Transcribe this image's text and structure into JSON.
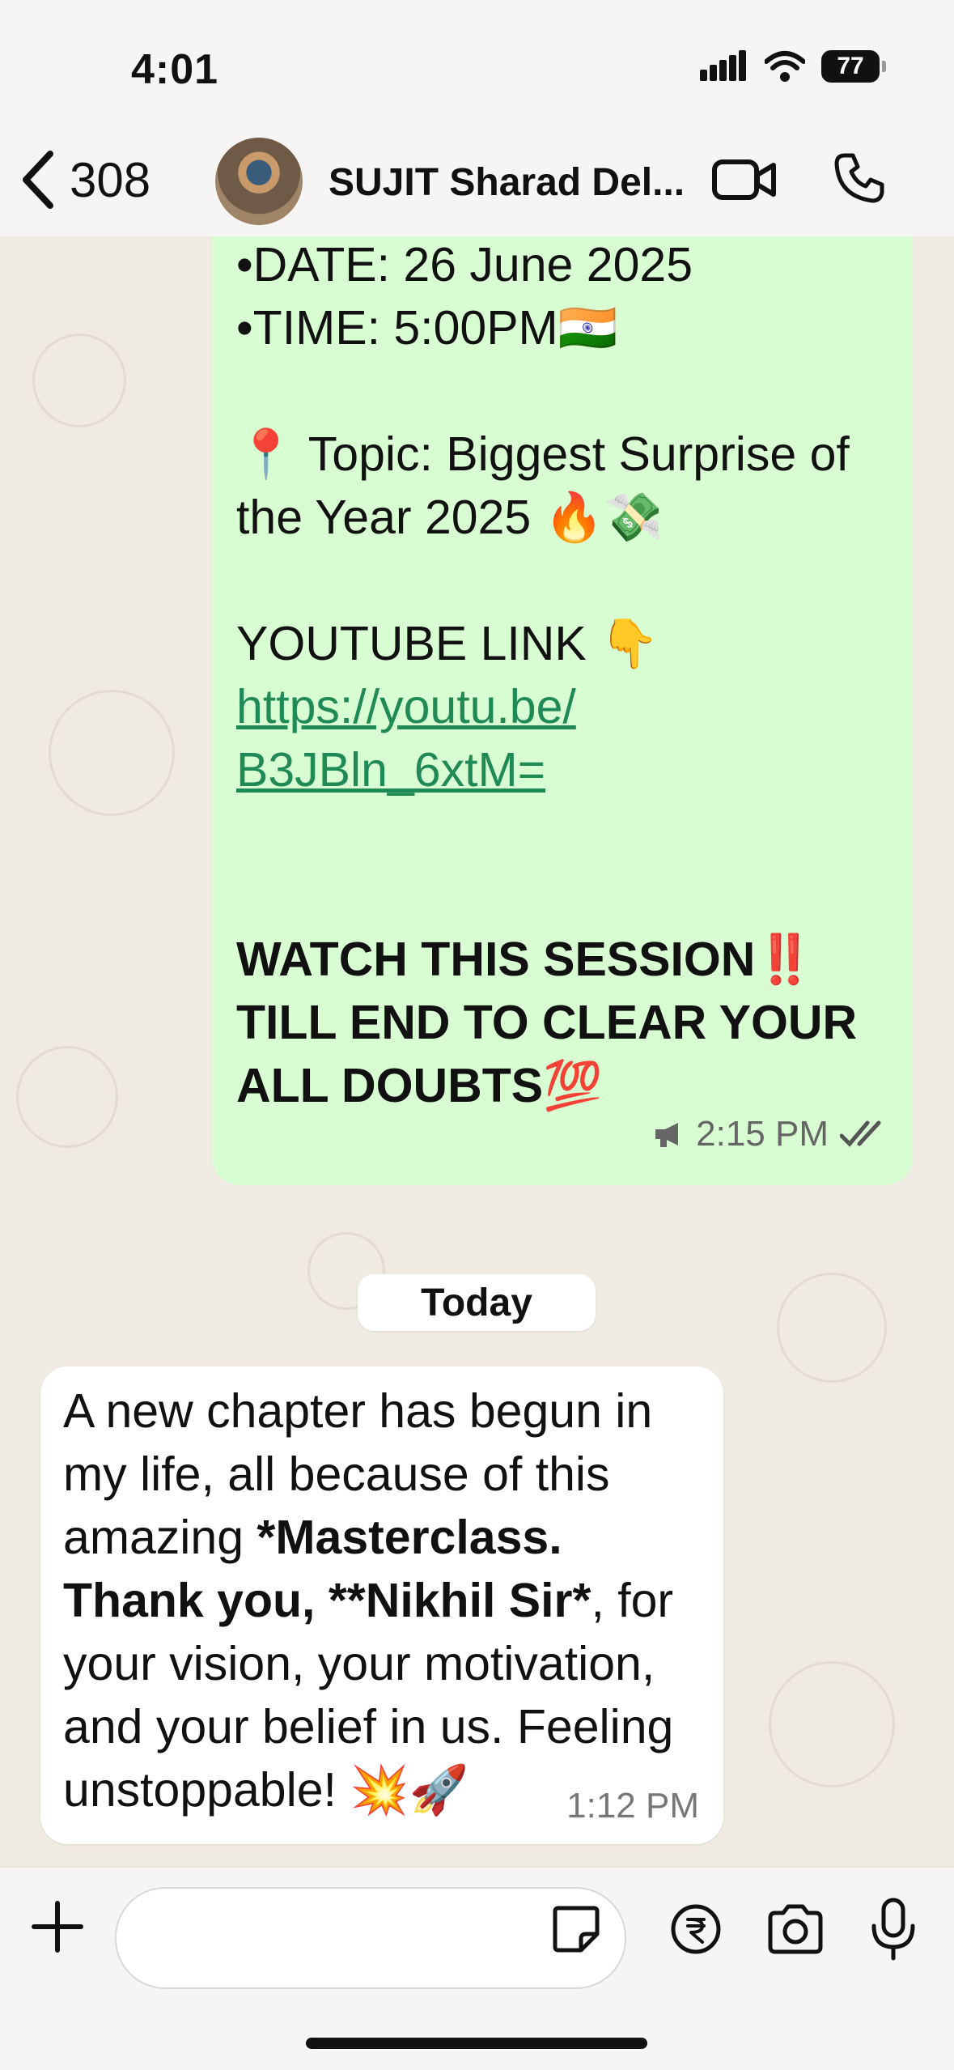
{
  "status_bar": {
    "time": "4:01",
    "battery": "77"
  },
  "header": {
    "back_count": "308",
    "contact_name": "SUJIT Sharad Del..."
  },
  "messages": {
    "outgoing": {
      "date_line": "•DATE: 26 June 2025",
      "time_line": "•TIME: 5:00PM🇮🇳",
      "topic_line1": "📍 Topic: Biggest Surprise of",
      "topic_line2": "the Year 2025 🔥💸",
      "youtube_label": "YOUTUBE LINK 👇",
      "link_line1": "https://youtu.be/",
      "link_line2": "B3JBln_6xtM=",
      "watch_line1": "WATCH THIS SESSION‼️",
      "watch_line2": "TILL END TO CLEAR YOUR",
      "watch_line3": "ALL DOUBTS💯",
      "timestamp": "2:15 PM"
    },
    "date_separator": "Today",
    "incoming": {
      "part1": "A new chapter has begun in my life, all because of this amazing ",
      "bold": "*Masterclass. Thank you, **Nikhil Sir*",
      "part2": ", for your vision, your motivation, and your belief in us. Feeling unstoppable! 💥🚀",
      "timestamp": "1:12 PM"
    }
  },
  "input": {
    "value": "",
    "placeholder": ""
  },
  "colors": {
    "outgoing_bubble": "#d9fdd3",
    "link": "#1f8a56",
    "chat_bg": "#efeae2"
  }
}
